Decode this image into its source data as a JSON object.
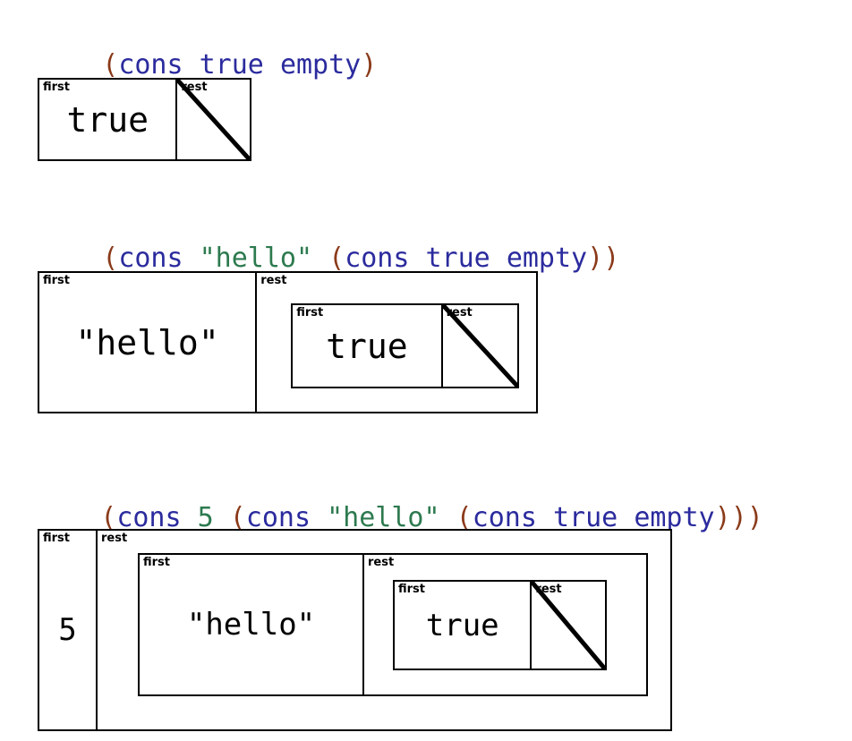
{
  "page": {
    "background": "#ffffff",
    "syntax_colors": {
      "paren": "#8B3A1A",
      "identifier": "#2B2B9E",
      "literal": "#2D7A4F",
      "box_stroke": "#000000",
      "label_text": "#000000"
    },
    "labels": {
      "first": "first",
      "rest": "rest"
    }
  },
  "examples": [
    {
      "expression_text": "(cons true empty)",
      "tokens": [
        {
          "t": "(",
          "kind": "paren"
        },
        {
          "t": "cons",
          "kind": "ident"
        },
        {
          "t": " ",
          "kind": "ident"
        },
        {
          "t": "true",
          "kind": "ident"
        },
        {
          "t": " ",
          "kind": "ident"
        },
        {
          "t": "empty",
          "kind": "ident"
        },
        {
          "t": ")",
          "kind": "paren"
        }
      ],
      "first_value": "true",
      "rest_value": "empty"
    },
    {
      "expression_text": "(cons \"hello\" (cons true empty))",
      "tokens": [
        {
          "t": "(",
          "kind": "paren"
        },
        {
          "t": "cons",
          "kind": "ident"
        },
        {
          "t": " ",
          "kind": "ident"
        },
        {
          "t": "\"hello\"",
          "kind": "lit"
        },
        {
          "t": " ",
          "kind": "ident"
        },
        {
          "t": "(",
          "kind": "paren"
        },
        {
          "t": "cons",
          "kind": "ident"
        },
        {
          "t": " ",
          "kind": "ident"
        },
        {
          "t": "true",
          "kind": "ident"
        },
        {
          "t": " ",
          "kind": "ident"
        },
        {
          "t": "empty",
          "kind": "ident"
        },
        {
          "t": ")",
          "kind": "paren"
        },
        {
          "t": ")",
          "kind": "paren"
        }
      ],
      "first_value": "\"hello\"",
      "inner_first_value": "true",
      "rest_value": "empty"
    },
    {
      "expression_text": "(cons 5 (cons \"hello\" (cons true empty)))",
      "tokens": [
        {
          "t": "(",
          "kind": "paren"
        },
        {
          "t": "cons",
          "kind": "ident"
        },
        {
          "t": " ",
          "kind": "ident"
        },
        {
          "t": "5",
          "kind": "lit"
        },
        {
          "t": " ",
          "kind": "ident"
        },
        {
          "t": "(",
          "kind": "paren"
        },
        {
          "t": "cons",
          "kind": "ident"
        },
        {
          "t": " ",
          "kind": "ident"
        },
        {
          "t": "\"hello\"",
          "kind": "lit"
        },
        {
          "t": " ",
          "kind": "ident"
        },
        {
          "t": "(",
          "kind": "paren"
        },
        {
          "t": "cons",
          "kind": "ident"
        },
        {
          "t": " ",
          "kind": "ident"
        },
        {
          "t": "true",
          "kind": "ident"
        },
        {
          "t": " ",
          "kind": "ident"
        },
        {
          "t": "empty",
          "kind": "ident"
        },
        {
          "t": ")",
          "kind": "paren"
        },
        {
          "t": ")",
          "kind": "paren"
        },
        {
          "t": ")",
          "kind": "paren"
        }
      ],
      "first_value": "5",
      "inner_first_value": "\"hello\"",
      "innermost_first_value": "true",
      "rest_value": "empty"
    }
  ],
  "diagram1": {
    "first_label": "first",
    "rest_label": "rest",
    "first_value": "true"
  },
  "diagram2": {
    "first_label": "first",
    "rest_label": "rest",
    "first_value": "\"hello\"",
    "inner": {
      "first_label": "first",
      "rest_label": "rest",
      "first_value": "true"
    }
  },
  "diagram3": {
    "first_label": "first",
    "rest_label": "rest",
    "first_value": "5",
    "inner": {
      "first_label": "first",
      "rest_label": "rest",
      "first_value": "\"hello\"",
      "inner": {
        "first_label": "first",
        "rest_label": "rest",
        "first_value": "true"
      }
    }
  }
}
